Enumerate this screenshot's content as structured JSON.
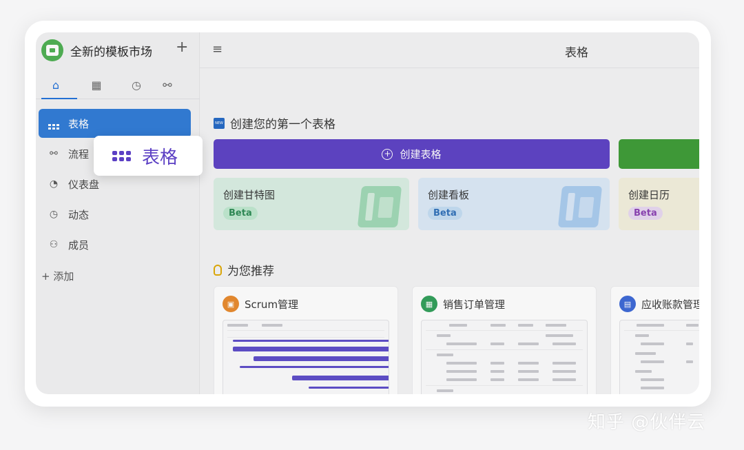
{
  "app": {
    "name": "全新的模板市场",
    "add_symbol": "+"
  },
  "sidebar": {
    "tabs": [
      {
        "icon": "home-icon",
        "glyph": "⌂",
        "active": true
      },
      {
        "icon": "table-icon",
        "glyph": "▦",
        "active": false
      },
      {
        "icon": "clock-icon",
        "glyph": "◷",
        "active": false
      },
      {
        "icon": "flow-icon",
        "glyph": "⚯",
        "active": false
      }
    ],
    "items": [
      {
        "label": "表格",
        "icon": "grid-icon",
        "active": true
      },
      {
        "label": "流程",
        "icon": "flow-icon",
        "active": false
      },
      {
        "label": "仪表盘",
        "icon": "dashboard-icon",
        "active": false
      },
      {
        "label": "动态",
        "icon": "clock-icon",
        "active": false
      },
      {
        "label": "成员",
        "icon": "members-icon",
        "active": false
      }
    ],
    "add_label": "+ 添加"
  },
  "header": {
    "menu_icon": "menu-icon",
    "title": "表格"
  },
  "main": {
    "first_table": {
      "badge": "NEW",
      "title": "创建您的第一个表格"
    },
    "create_button": {
      "label": "创建表格"
    },
    "cards": [
      {
        "title": "创建甘特图",
        "badge": "Beta",
        "bg": "#d9efe3",
        "badge_bg": "#bfe8cf",
        "badge_color": "#2a8a52",
        "deco": "#9fd8b5"
      },
      {
        "title": "创建看板",
        "badge": "Beta",
        "bg": "#dbe9f7",
        "badge_bg": "#c3dcf3",
        "badge_color": "#2d6fb8",
        "deco": "#a8cbef"
      },
      {
        "title": "创建日历",
        "badge": "Beta",
        "bg": "#f3f0dc",
        "badge_bg": "#e7d7f1",
        "badge_color": "#8a3fb2",
        "deco": "#e9e3b5"
      }
    ],
    "recommend_title": "为您推荐",
    "recommendations": [
      {
        "title": "Scrum管理",
        "icon": "calendar-icon",
        "color": "#e8892a"
      },
      {
        "title": "销售订单管理",
        "icon": "table-icon",
        "color": "#2e9e58"
      },
      {
        "title": "应收账款管理",
        "icon": "folder-icon",
        "color": "#3a67d6"
      }
    ]
  },
  "callout": {
    "label": "表格"
  },
  "watermark": "知乎 @伙伴云"
}
